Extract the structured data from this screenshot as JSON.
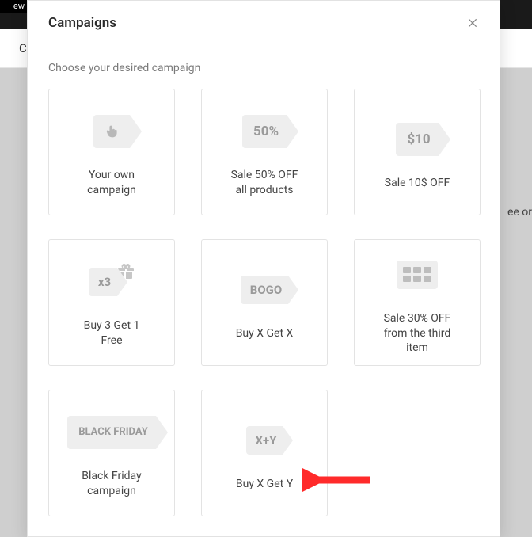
{
  "background": {
    "top_button_fragment": "ew",
    "strip_initial": "C",
    "right_text_fragment": "ee or"
  },
  "modal": {
    "title": "Campaigns",
    "subtitle": "Choose your desired campaign"
  },
  "cards": [
    {
      "badge": "",
      "label": "Your own\ncampaign"
    },
    {
      "badge": "50%",
      "label": "Sale 50% OFF\nall products"
    },
    {
      "badge": "$10",
      "label": "Sale 10$ OFF"
    },
    {
      "badge": "x3",
      "label": "Buy 3 Get 1\nFree"
    },
    {
      "badge": "BOGO",
      "label": "Buy X Get X"
    },
    {
      "badge": "",
      "label": "Sale 30% OFF\nfrom the third\nitem"
    },
    {
      "badge": "BLACK\nFRIDAY",
      "label": "Black Friday\ncampaign"
    },
    {
      "badge": "X+Y",
      "label": "Buy X Get Y"
    }
  ],
  "annotation": {
    "arrow_color": "#ff2a2a"
  }
}
